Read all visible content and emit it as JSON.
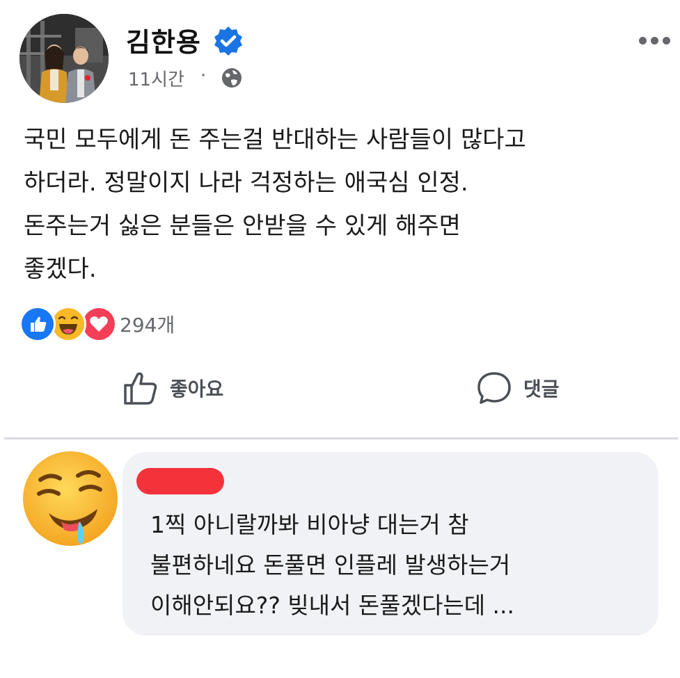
{
  "post": {
    "author": "김한용",
    "time": "11시간",
    "separator": "·",
    "body_lines": [
      "국민 모두에게 돈 주는걸 반대하는 사람들이 많다고",
      "하더라. 정말이지 나라 걱정하는 애국심 인정.",
      "돈주는거 싫은 분들은 안받을 수 있게 해주면",
      "좋겠다."
    ],
    "reaction_count": "294개"
  },
  "actions": {
    "like_label": "좋아요",
    "comment_label": "댓글"
  },
  "comment": {
    "lines": [
      "1찍 아니랄까봐 비아냥 대는거 참",
      "불편하네요 돈풀면 인플레 발생하는거",
      "이해안되요?? 빚내서 돈풀겠다는데 ..."
    ]
  },
  "colors": {
    "verified": "#1b74e4",
    "like_reaction": "#1877f2",
    "love_reaction": "#f33e58",
    "haha_reaction": "#f7b928",
    "redaction": "#f4323a",
    "bubble": "#f0f2f5",
    "secondary_text": "#65676b"
  },
  "icons": [
    "verified-badge-icon",
    "globe-icon",
    "more-options-icon",
    "like-reaction-icon",
    "haha-reaction-icon",
    "love-reaction-icon",
    "thumbs-up-icon",
    "comment-icon",
    "commenter-emoji-avatar"
  ]
}
